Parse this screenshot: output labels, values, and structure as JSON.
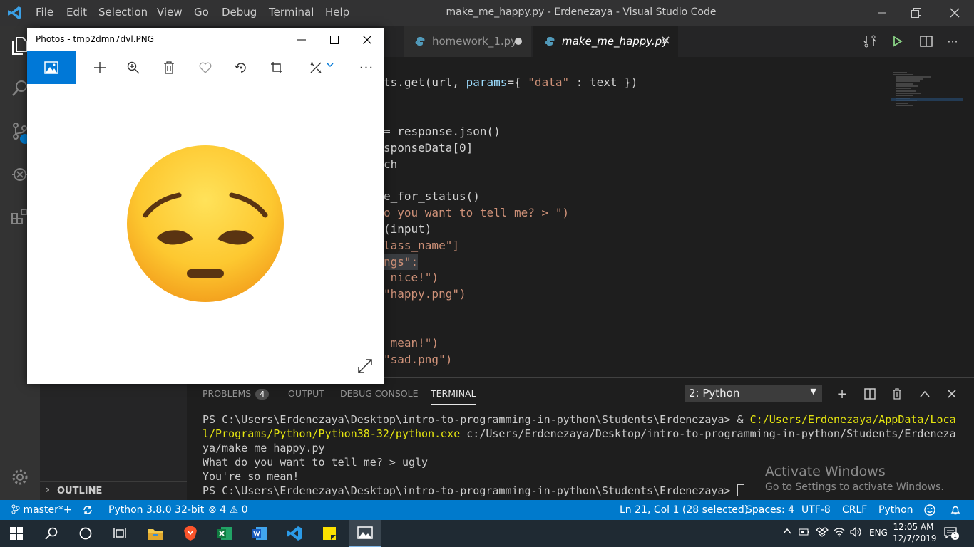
{
  "window_title": "make_me_happy.py - Erdenezaya - Visual Studio Code",
  "menu": [
    "File",
    "Edit",
    "Selection",
    "View",
    "Go",
    "Debug",
    "Terminal",
    "Help"
  ],
  "tabs": [
    {
      "label": "homework_1.py",
      "dirty": true
    },
    {
      "label": "make_me_happy.py",
      "dirty": false
    }
  ],
  "code": {
    "l1": [
      "ts.get(url, ",
      "params",
      "={ ",
      "\"data\"",
      " : text })"
    ],
    "l2": "= response.json()",
    "l3": "sponseData[0]",
    "l4": "ch",
    "l5": "e_for_status()",
    "l6": "o you want to tell me? > \")",
    "l7": "(input)",
    "l8": "lass_name\"]",
    "l9": "ngs\":",
    "l10": " nice!\")",
    "l11": "\"happy.png\")",
    "l12": " mean!\")",
    "l13": "\"sad.png\")"
  },
  "panel": {
    "tabs": [
      "PROBLEMS",
      "OUTPUT",
      "DEBUG CONSOLE",
      "TERMINAL"
    ],
    "problems_count": "4",
    "terminal_select": "2: Python",
    "terminal": {
      "l1a": "PS C:\\Users\\Erdenezaya\\Desktop\\intro-to-programming-in-python\\Students\\Erdenezaya> & ",
      "l1b": "C:/Users/Erdenezaya/AppData/Loca",
      "l2a": "l/Programs/Python/Python38-32/python.exe",
      "l2b": " c:/Users/Erdenezaya/Desktop/intro-to-programming-in-python/Students/Erdeneza",
      "l3": "ya/make_me_happy.py",
      "l4": "What do you want to tell me? > ugly",
      "l5": "You're so mean!",
      "l6": "PS C:\\Users\\Erdenezaya\\Desktop\\intro-to-programming-in-python\\Students\\Erdenezaya> "
    },
    "activate_title": "Activate Windows",
    "activate_sub": "Go to Settings to activate Windows."
  },
  "sidebar": {
    "outline_label": "OUTLINE"
  },
  "status": {
    "branch": "master*+",
    "interpreter": "Python 3.8.0 32-bit",
    "errors": "4",
    "warnings": "0",
    "position": "Ln 21, Col 1 (28 selected)",
    "spaces": "Spaces: 4",
    "encoding": "UTF-8",
    "eol": "CRLF",
    "language": "Python"
  },
  "photos": {
    "title": "Photos - tmp2dmn7dvl.PNG",
    "image_icon": "pensive-face-emoji"
  },
  "taskbar": {
    "language": "ENG",
    "time": "12:05 AM",
    "date": "12/7/2019",
    "notifications": "1"
  },
  "colors": {
    "accent": "#007acc",
    "photos_accent": "#0078d7",
    "string": "#ce9178",
    "param": "#9cdcfe"
  }
}
